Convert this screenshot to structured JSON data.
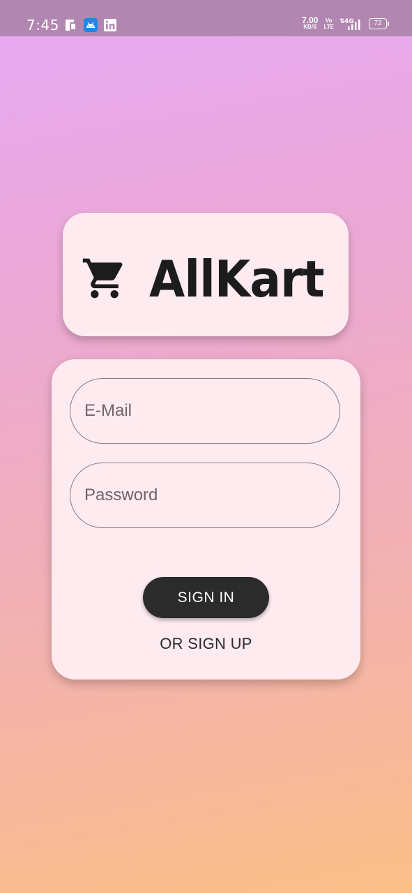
{
  "status_bar": {
    "time": "7:45",
    "icons_left": [
      "sim-card-icon",
      "android-icon",
      "linkedin-icon"
    ],
    "net_speed_value": "7.00",
    "net_speed_unit": "KB/S",
    "volte_top": "Vo",
    "volte_bottom": "LTE",
    "network": "4G",
    "battery": "72"
  },
  "logo": {
    "icon": "shopping-cart-icon",
    "title": "AllKart"
  },
  "form": {
    "email_placeholder": "E-Mail",
    "email_value": "",
    "password_placeholder": "Password",
    "password_value": "",
    "signin_label": "SIGN IN",
    "signup_label": "OR SIGN UP"
  },
  "colors": {
    "status_bar": "#b186b1",
    "card_bg": "#fdebf0",
    "button_bg": "#2b2b2b",
    "text_dark": "#1c1c1c",
    "gradient_top": "#e7a9f5",
    "gradient_bottom": "#fbc087"
  }
}
